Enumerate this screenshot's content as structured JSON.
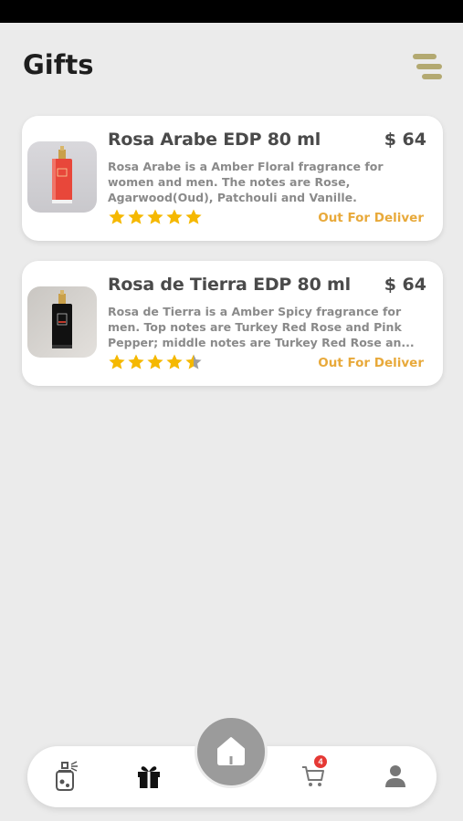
{
  "header": {
    "title": "Gifts"
  },
  "products": [
    {
      "name": "Rosa Arabe EDP 80 ml",
      "price": "$ 64",
      "description_lines": [
        "Rosa Arabe is a Amber Floral fragrance for",
        "women and men. The notes are Rose,",
        "Agarwood(Oud), Patchouli and Vanille."
      ],
      "rating": 5,
      "status": "Out For Deliver",
      "bottle_color": "#e8473a"
    },
    {
      "name": "Rosa de Tierra EDP 80 ml",
      "price": "$ 64",
      "description_lines": [
        "Rosa de Tierra is a Amber Spicy fragrance for",
        "men. Top notes are Turkey Red Rose and Pink",
        "Pepper; middle notes are Turkey Red Rose an..."
      ],
      "rating": 4.5,
      "status": "Out For Deliver",
      "bottle_color": "#111111"
    }
  ],
  "bottom_nav": {
    "items": [
      "perfume-icon",
      "gift-icon",
      "home-icon",
      "cart-icon",
      "profile-icon"
    ],
    "active": "gift-icon",
    "cart_badge": "4"
  },
  "colors": {
    "accent": "#b3a971",
    "star": "#f5b800",
    "status": "#e8a93a",
    "badge": "#e53935"
  }
}
